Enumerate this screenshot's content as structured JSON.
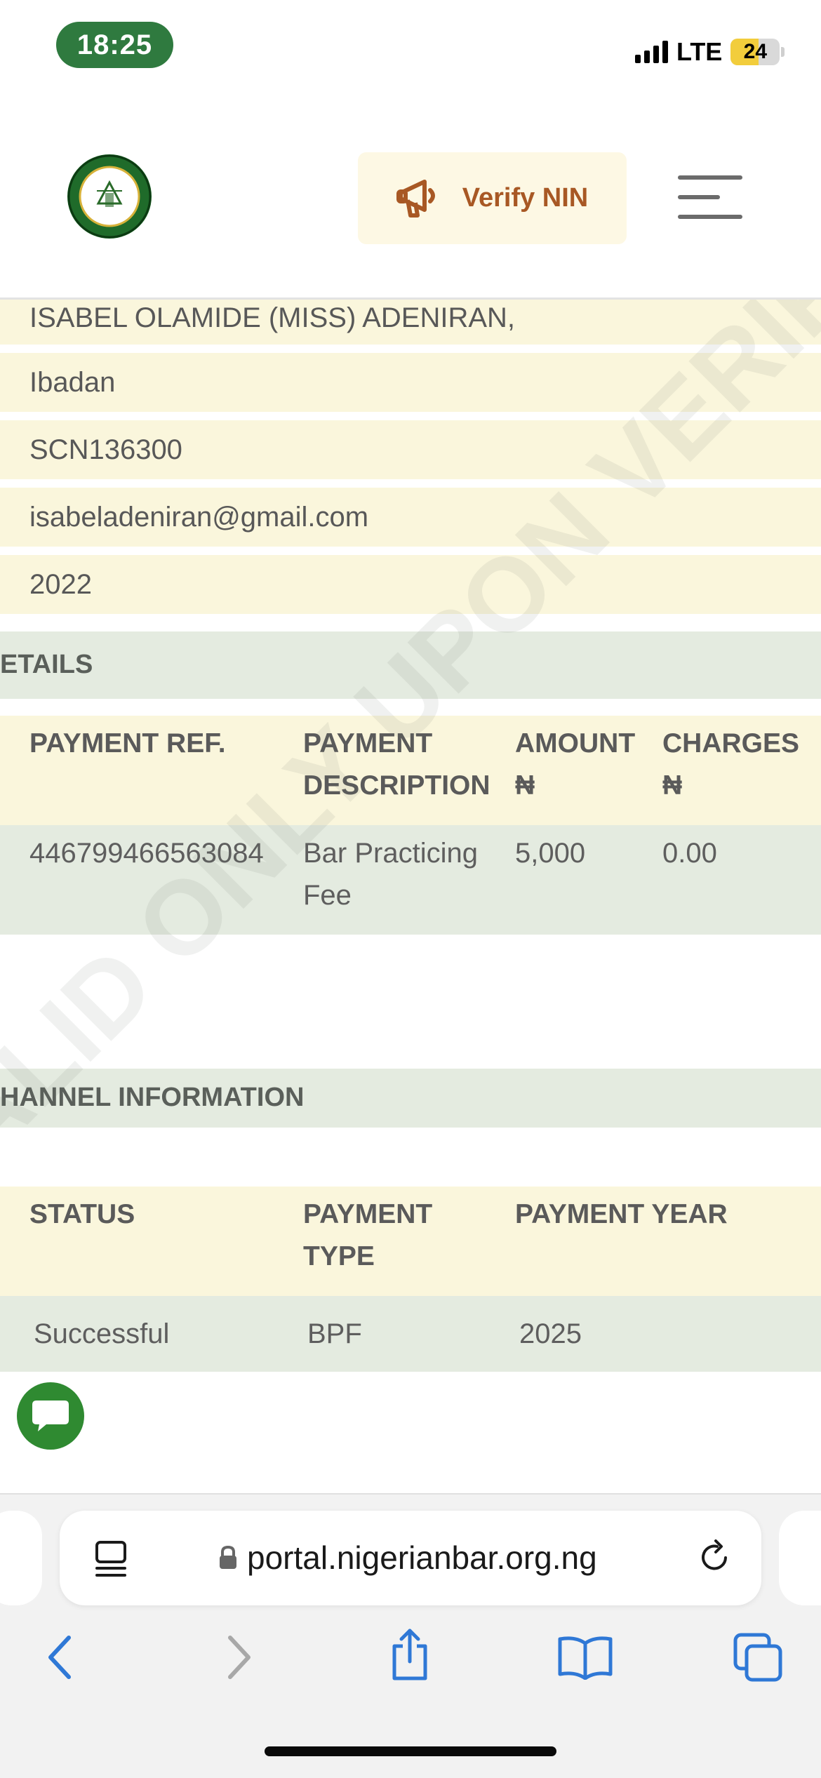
{
  "status_bar": {
    "time": "18:25",
    "network": "LTE",
    "battery": "24"
  },
  "header": {
    "logo_text": "NIGERIAN BAR ASSOCIATION",
    "verify_label": "Verify NIN"
  },
  "member_info": {
    "name": "ISABEL OLAMIDE (MISS) ADENIRAN,",
    "branch": "Ibadan",
    "scn": "SCN136300",
    "email": "isabeladeniran@gmail.com",
    "year": "2022"
  },
  "payment_details": {
    "title": "ETAILS",
    "headers": [
      "PAYMENT REF.",
      "PAYMENT DESCRIPTION",
      "AMOUNT ₦",
      "CHARGES ₦"
    ],
    "row": {
      "ref": "446799466563084",
      "description": "Bar Practicing Fee",
      "amount": "5,000",
      "charges": "0.00"
    }
  },
  "channel_info": {
    "title": "HANNEL INFORMATION",
    "headers": [
      "STATUS",
      "PAYMENT TYPE",
      "PAYMENT YEAR"
    ],
    "row": {
      "status": "Successful",
      "type": "BPF",
      "year": "2025"
    }
  },
  "watermark": "VALID ONLY UPON VERIFICATION",
  "browser": {
    "url": "portal.nigerianbar.org.ng"
  },
  "colors": {
    "brand_green": "#2f7a3f",
    "row_yellow": "#faf6dc",
    "row_green": "#e4ebe0",
    "verify_text": "#a85824",
    "ios_blue": "#2f78d6"
  }
}
